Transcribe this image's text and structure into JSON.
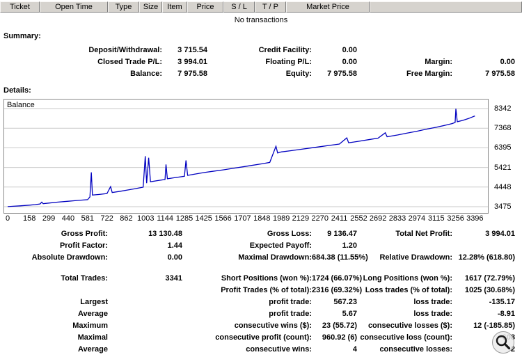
{
  "transactions": {
    "columns": [
      "Ticket",
      "Open Time",
      "Type",
      "Size",
      "Item",
      "Price",
      "S / L",
      "T / P",
      "Market Price",
      ""
    ],
    "empty_text": "No transactions"
  },
  "summary": {
    "title": "Summary:",
    "rows": [
      [
        "Deposit/Withdrawal:",
        "3 715.54",
        "Credit Facility:",
        "0.00",
        "",
        ""
      ],
      [
        "Closed Trade P/L:",
        "3 994.01",
        "Floating P/L:",
        "0.00",
        "Margin:",
        "0.00"
      ],
      [
        "Balance:",
        "7 975.58",
        "Equity:",
        "7 975.58",
        "Free Margin:",
        "7 975.58"
      ]
    ]
  },
  "details": {
    "title": "Details:"
  },
  "chart_data": {
    "type": "line",
    "title": "Balance",
    "series_label": "Balance",
    "line_color": "#0000C0",
    "grid_color": "#C9C9C9",
    "legend_position": "top-left",
    "grid": "horizontal",
    "xlim": [
      0,
      3450
    ],
    "ylim": [
      3475,
      8342
    ],
    "xticks": [
      0,
      158,
      299,
      440,
      581,
      722,
      862,
      1003,
      1144,
      1285,
      1425,
      1566,
      1707,
      1848,
      1989,
      2129,
      2270,
      2411,
      2552,
      2692,
      2833,
      2974,
      3115,
      3256,
      3396
    ],
    "yticks": [
      3475,
      4448,
      5421,
      6395,
      7368,
      8342
    ],
    "points": [
      [
        0,
        3480
      ],
      [
        40,
        3495
      ],
      [
        90,
        3515
      ],
      [
        158,
        3550
      ],
      [
        200,
        3580
      ],
      [
        235,
        3610
      ],
      [
        248,
        3700
      ],
      [
        258,
        3625
      ],
      [
        299,
        3655
      ],
      [
        360,
        3700
      ],
      [
        440,
        3745
      ],
      [
        510,
        3785
      ],
      [
        581,
        3825
      ],
      [
        598,
        3960
      ],
      [
        608,
        5180
      ],
      [
        616,
        4050
      ],
      [
        660,
        4080
      ],
      [
        722,
        4125
      ],
      [
        748,
        4470
      ],
      [
        760,
        4175
      ],
      [
        820,
        4240
      ],
      [
        862,
        4290
      ],
      [
        920,
        4360
      ],
      [
        985,
        4440
      ],
      [
        1000,
        5980
      ],
      [
        1010,
        4640
      ],
      [
        1025,
        5900
      ],
      [
        1038,
        4710
      ],
      [
        1090,
        4770
      ],
      [
        1144,
        4825
      ],
      [
        1151,
        5570
      ],
      [
        1161,
        4860
      ],
      [
        1220,
        4920
      ],
      [
        1285,
        4985
      ],
      [
        1296,
        5770
      ],
      [
        1308,
        5030
      ],
      [
        1370,
        5100
      ],
      [
        1425,
        5165
      ],
      [
        1490,
        5230
      ],
      [
        1566,
        5300
      ],
      [
        1630,
        5370
      ],
      [
        1707,
        5450
      ],
      [
        1770,
        5520
      ],
      [
        1848,
        5600
      ],
      [
        1905,
        5670
      ],
      [
        1950,
        6470
      ],
      [
        1962,
        6140
      ],
      [
        1989,
        6190
      ],
      [
        2060,
        6255
      ],
      [
        2129,
        6320
      ],
      [
        2200,
        6385
      ],
      [
        2270,
        6450
      ],
      [
        2340,
        6515
      ],
      [
        2411,
        6580
      ],
      [
        2465,
        6890
      ],
      [
        2478,
        6645
      ],
      [
        2552,
        6720
      ],
      [
        2620,
        6795
      ],
      [
        2692,
        6875
      ],
      [
        2745,
        7140
      ],
      [
        2758,
        6945
      ],
      [
        2833,
        7030
      ],
      [
        2900,
        7120
      ],
      [
        2974,
        7215
      ],
      [
        3040,
        7315
      ],
      [
        3115,
        7415
      ],
      [
        3180,
        7515
      ],
      [
        3230,
        7595
      ],
      [
        3252,
        7650
      ],
      [
        3258,
        8330
      ],
      [
        3268,
        7690
      ],
      [
        3310,
        7760
      ],
      [
        3350,
        7850
      ],
      [
        3396,
        7975
      ]
    ]
  },
  "stats": {
    "rows": [
      [
        "Gross Profit:",
        "13 130.48",
        "Gross Loss:",
        "9 136.47",
        "Total Net Profit:",
        "3 994.01"
      ],
      [
        "Profit Factor:",
        "1.44",
        "Expected Payoff:",
        "1.20",
        "",
        ""
      ],
      [
        "Absolute Drawdown:",
        "0.00",
        "Maximal Drawdown:",
        "684.38 (11.55%)",
        "Relative Drawdown:",
        "12.28% (618.80)"
      ],
      [],
      [
        "Total Trades:",
        "3341",
        "Short Positions (won %):",
        "1724 (66.07%)",
        "Long Positions (won %):",
        "1617 (72.79%)"
      ],
      [
        "",
        "",
        "Profit Trades (% of total):",
        "2316 (69.32%)",
        "Loss trades (% of total):",
        "1025 (30.68%)"
      ],
      [
        "Largest",
        "",
        "profit trade:",
        "567.23",
        "loss trade:",
        "-135.17"
      ],
      [
        "Average",
        "",
        "profit trade:",
        "5.67",
        "loss trade:",
        "-8.91"
      ],
      [
        "Maximum",
        "",
        "consecutive wins ($):",
        "23 (55.72)",
        "consecutive losses ($):",
        "12 (-185.85)"
      ],
      [
        "Maximal",
        "",
        "consecutive profit (count):",
        "960.92 (6)",
        "consecutive loss (count):",
        "-608"
      ],
      [
        "Average",
        "",
        "consecutive wins:",
        "4",
        "consecutive losses:",
        "2"
      ]
    ]
  }
}
